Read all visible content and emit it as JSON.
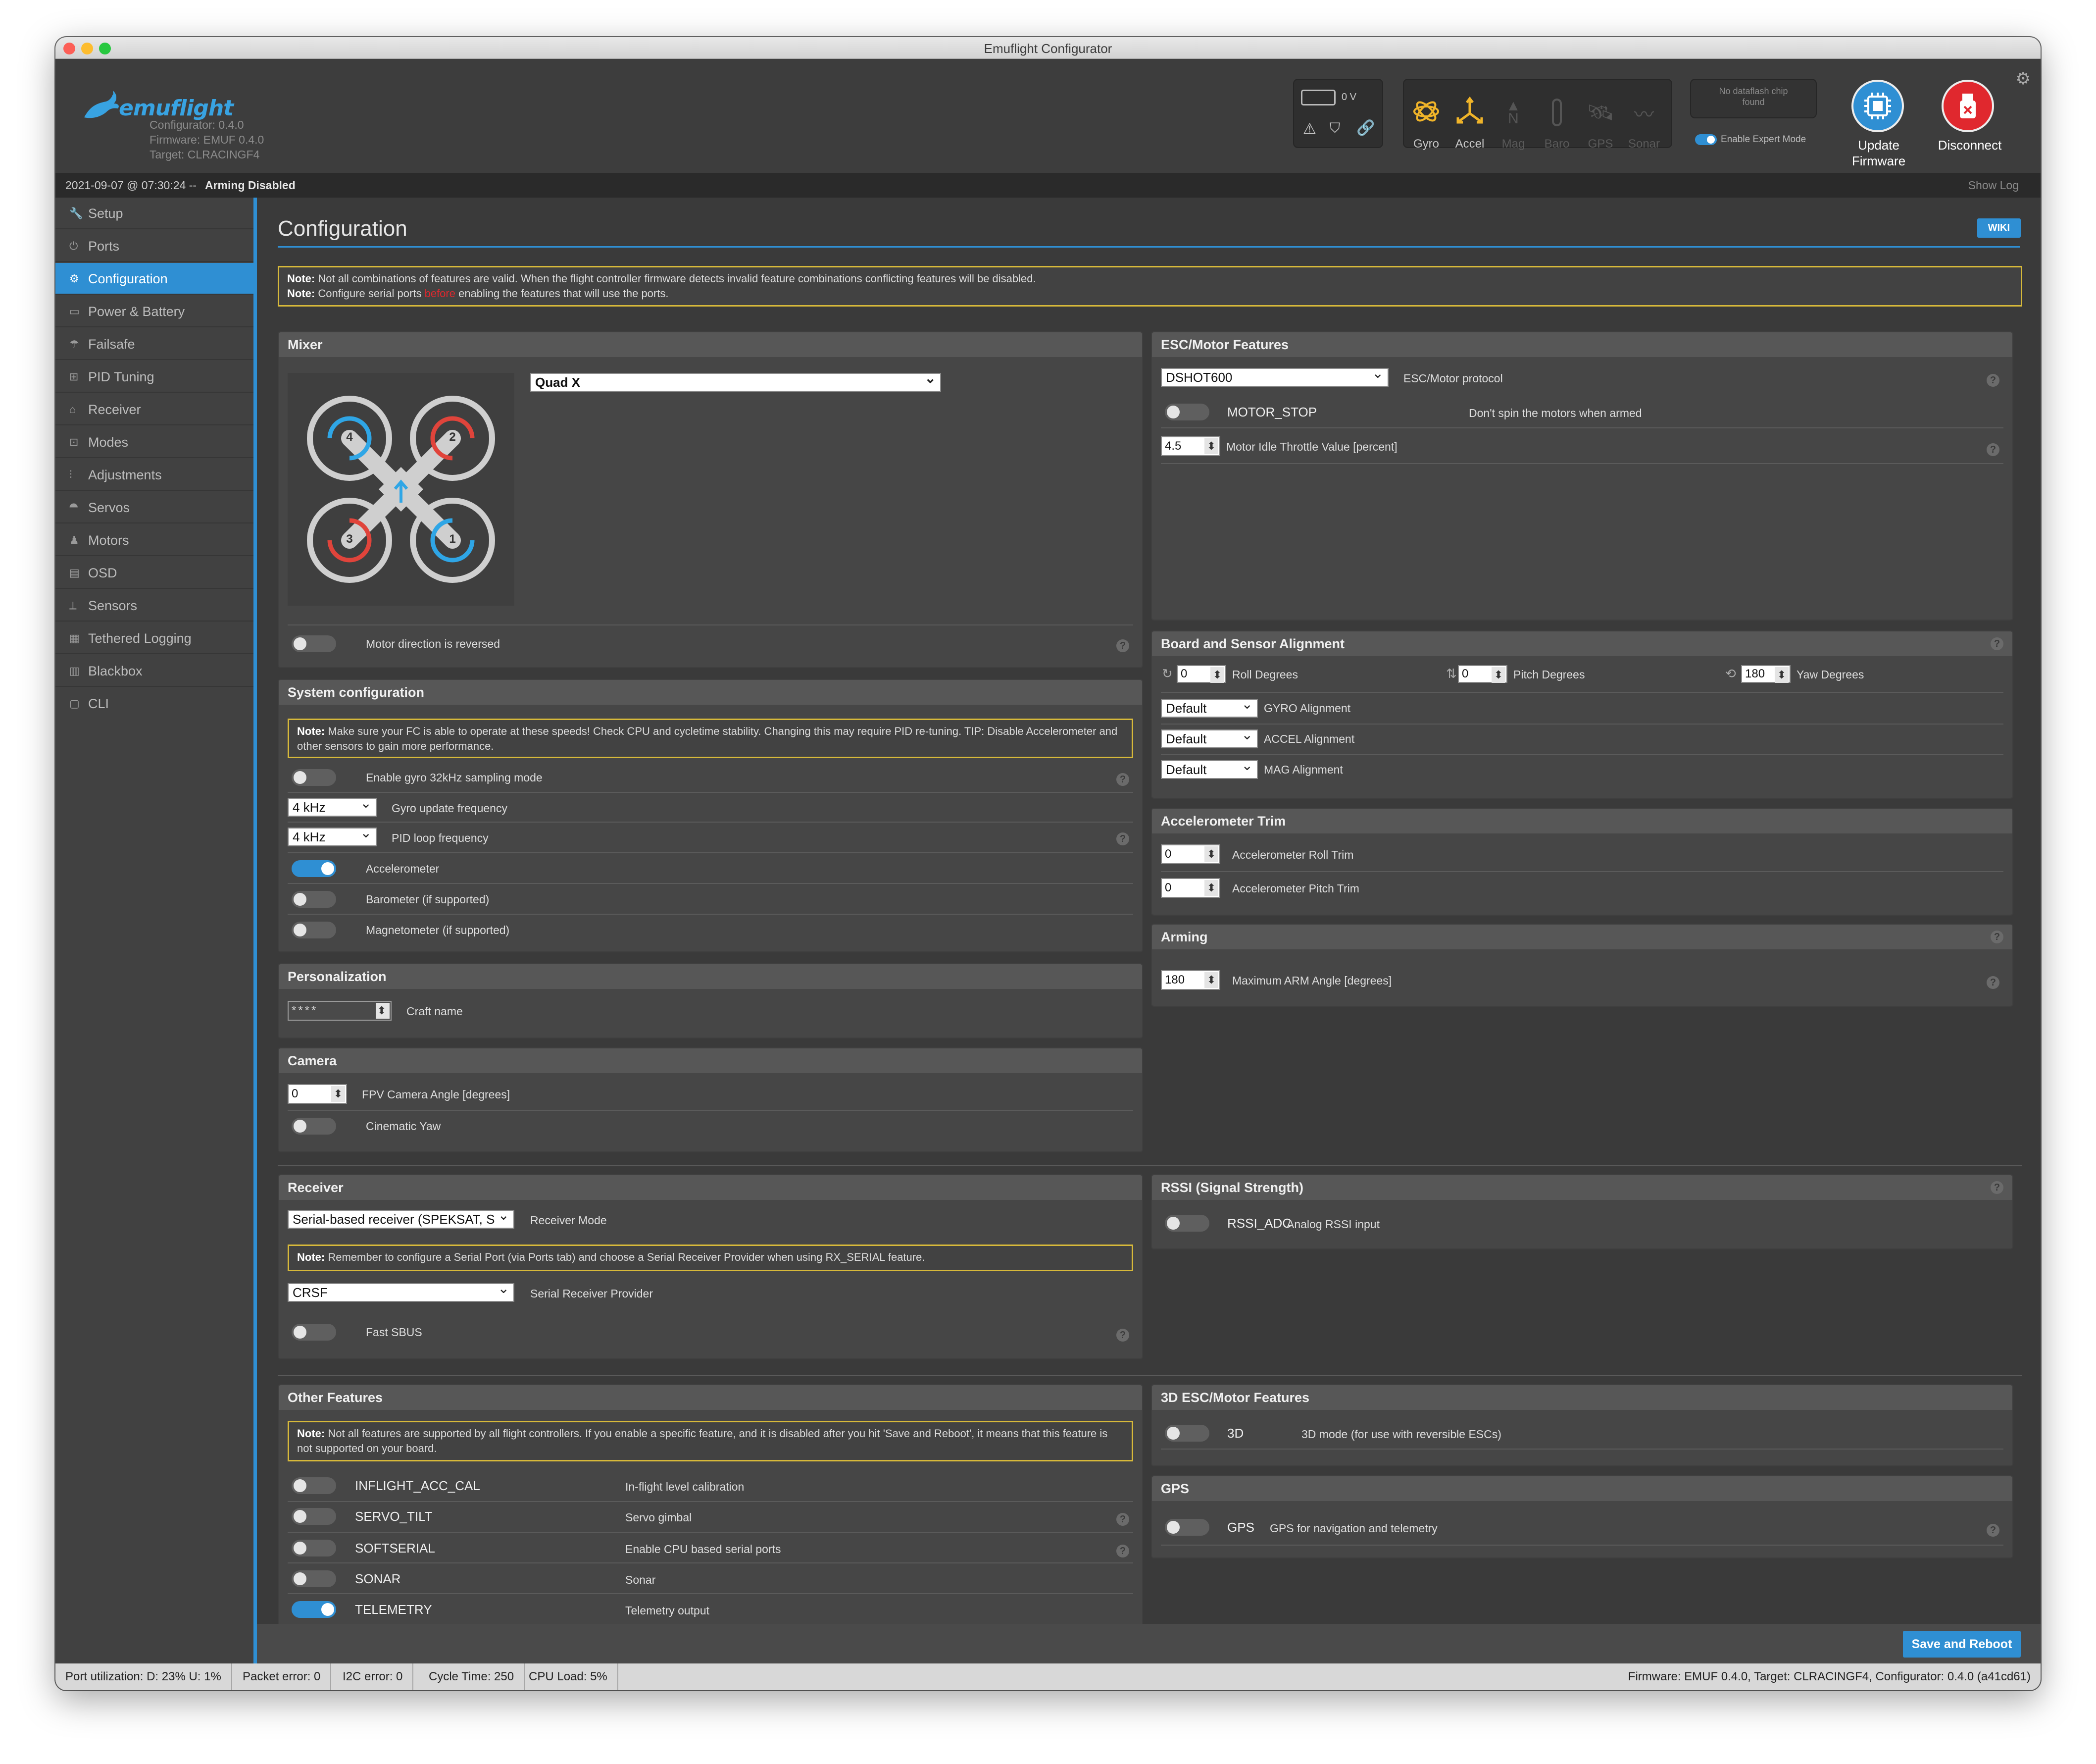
{
  "window": {
    "title": "Emuflight Configurator"
  },
  "header": {
    "logo_text": "emuflight",
    "configurator_version": "Configurator: 0.4.0",
    "firmware_version": "Firmware: EMUF 0.4.0",
    "target": "Target: CLRACINGF4",
    "battery_voltage": "0 V",
    "sensors": [
      {
        "label": "Gyro",
        "active": true
      },
      {
        "label": "Accel",
        "active": true
      },
      {
        "label": "Mag",
        "active": false
      },
      {
        "label": "Baro",
        "active": false
      },
      {
        "label": "GPS",
        "active": false
      },
      {
        "label": "Sonar",
        "active": false
      }
    ],
    "dataflash": "No dataflash chip found",
    "expert_mode_label": "Enable Expert Mode",
    "update_firmware": "Update Firmware",
    "disconnect": "Disconnect"
  },
  "status": {
    "timestamp": "2021-09-07 @ 07:30:24 --",
    "state": "Arming Disabled",
    "show_log": "Show Log"
  },
  "sidebar": {
    "items": [
      {
        "label": "Setup"
      },
      {
        "label": "Ports"
      },
      {
        "label": "Configuration",
        "active": true
      },
      {
        "label": "Power & Battery"
      },
      {
        "label": "Failsafe"
      },
      {
        "label": "PID Tuning"
      },
      {
        "label": "Receiver"
      },
      {
        "label": "Modes"
      },
      {
        "label": "Adjustments"
      },
      {
        "label": "Servos"
      },
      {
        "label": "Motors"
      },
      {
        "label": "OSD"
      },
      {
        "label": "Sensors"
      },
      {
        "label": "Tethered Logging"
      },
      {
        "label": "Blackbox"
      },
      {
        "label": "CLI"
      }
    ]
  },
  "page": {
    "title": "Configuration",
    "wiki": "WIKI",
    "note1_b": "Note:",
    "note1": "Not all combinations of features are valid. When the flight controller firmware detects invalid feature combinations conflicting features will be disabled.",
    "note2_b": "Note:",
    "note2a": "Configure serial ports",
    "note2red": "before",
    "note2b": "enabling the features that will use the ports."
  },
  "mixer": {
    "title": "Mixer",
    "selected": "Quad X",
    "motor_labels": [
      "4",
      "2",
      "3",
      "1"
    ],
    "reversed_label": "Motor direction is reversed"
  },
  "system": {
    "title": "System configuration",
    "note_b": "Note:",
    "note": "Make sure your FC is able to operate at these speeds! Check CPU and cycletime stability. Changing this may require PID re-tuning. TIP: Disable Accelerometer and other sensors to gain more performance.",
    "gyro32": "Enable gyro 32kHz sampling mode",
    "gyro_freq": "4 kHz",
    "gyro_freq_label": "Gyro update frequency",
    "pid_freq": "4 kHz",
    "pid_freq_label": "PID loop frequency",
    "accel": "Accelerometer",
    "baro": "Barometer (if supported)",
    "mag": "Magnetometer (if supported)"
  },
  "personalization": {
    "title": "Personalization",
    "craft_name_value": "****",
    "craft_name_label": "Craft name"
  },
  "camera": {
    "title": "Camera",
    "angle_value": "0",
    "angle_label": "FPV Camera Angle [degrees]",
    "cinematic": "Cinematic Yaw"
  },
  "receiver": {
    "title": "Receiver",
    "mode": "Serial-based receiver (SPEKSAT, S",
    "mode_label": "Receiver Mode",
    "note_b": "Note:",
    "note": "Remember to configure a Serial Port (via Ports tab) and choose a Serial Receiver Provider when using RX_SERIAL feature.",
    "provider": "CRSF",
    "provider_label": "Serial Receiver Provider",
    "fast_sbus": "Fast SBUS"
  },
  "other": {
    "title": "Other Features",
    "note_b": "Note:",
    "note": "Not all features are supported by all flight controllers. If you enable a specific feature, and it is disabled after you hit 'Save and Reboot', it means that this feature is not supported on your board.",
    "features": [
      {
        "name": "INFLIGHT_ACC_CAL",
        "desc": "In-flight level calibration",
        "on": false
      },
      {
        "name": "SERVO_TILT",
        "desc": "Servo gimbal",
        "on": false
      },
      {
        "name": "SOFTSERIAL",
        "desc": "Enable CPU based serial ports",
        "on": false
      },
      {
        "name": "SONAR",
        "desc": "Sonar",
        "on": false
      },
      {
        "name": "TELEMETRY",
        "desc": "Telemetry output",
        "on": true
      }
    ]
  },
  "esc": {
    "title": "ESC/Motor Features",
    "protocol": "DSHOT600",
    "protocol_label": "ESC/Motor protocol",
    "motor_stop": "MOTOR_STOP",
    "motor_stop_desc": "Don't spin the motors when armed",
    "idle_value": "4.5",
    "idle_label": "Motor Idle Throttle Value [percent]"
  },
  "alignment": {
    "title": "Board and Sensor Alignment",
    "roll": "0",
    "roll_label": "Roll Degrees",
    "pitch": "0",
    "pitch_label": "Pitch Degrees",
    "yaw": "180",
    "yaw_label": "Yaw Degrees",
    "gyro": "Default",
    "gyro_label": "GYRO Alignment",
    "accel": "Default",
    "accel_label": "ACCEL Alignment",
    "mag": "Default",
    "mag_label": "MAG Alignment"
  },
  "acctrim": {
    "title": "Accelerometer Trim",
    "roll": "0",
    "roll_label": "Accelerometer Roll Trim",
    "pitch": "0",
    "pitch_label": "Accelerometer Pitch Trim"
  },
  "arming": {
    "title": "Arming",
    "angle": "180",
    "angle_label": "Maximum ARM Angle [degrees]"
  },
  "rssi": {
    "title": "RSSI (Signal Strength)",
    "name": "RSSI_ADC",
    "desc": "Analog RSSI input"
  },
  "esc3d": {
    "title": "3D ESC/Motor Features",
    "name": "3D",
    "desc": "3D mode (for use with reversible ESCs)"
  },
  "gps": {
    "title": "GPS",
    "name": "GPS",
    "desc": "GPS for navigation and telemetry"
  },
  "save": "Save and Reboot",
  "footer": {
    "port": "Port utilization: D: 23% U: 1%",
    "packet": "Packet error: 0",
    "i2c": "I2C error: 0",
    "cycle": "Cycle Time: 250",
    "cpu": "CPU Load: 5%",
    "right": "Firmware: EMUF 0.4.0, Target: CLRACINGF4, Configurator: 0.4.0 (a41cd61)"
  },
  "colors": {
    "accent": "#2f8fd3",
    "note_border": "#d7b93a",
    "sensor_active": "#f0b429",
    "disconnect": "#e0282e"
  }
}
